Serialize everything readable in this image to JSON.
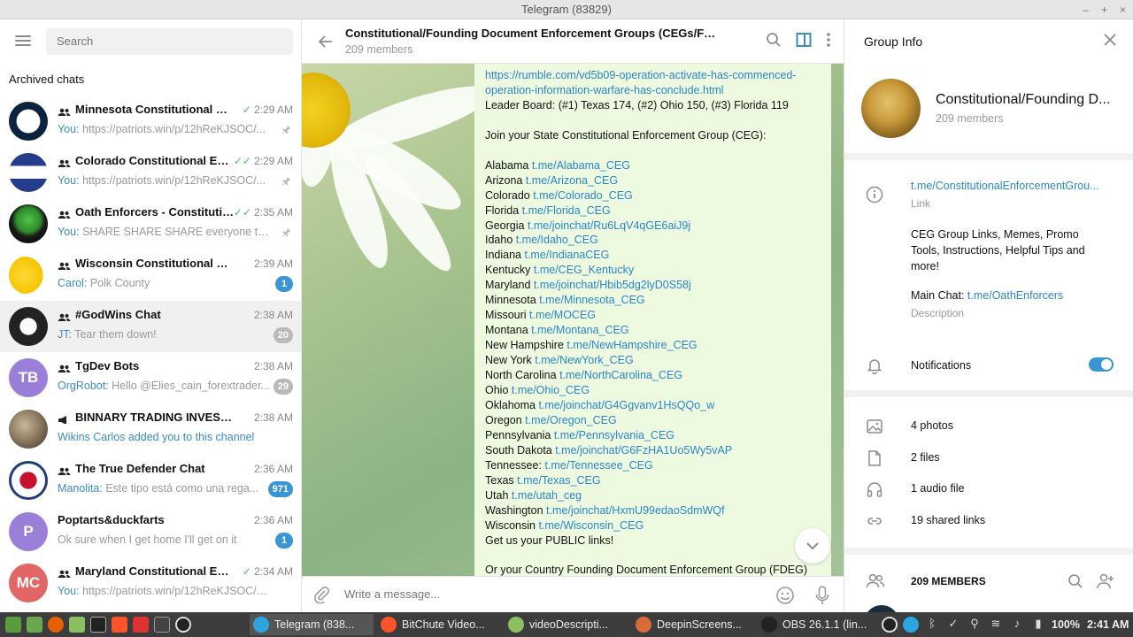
{
  "window": {
    "title": "Telegram (83829)"
  },
  "sidebar": {
    "search_placeholder": "Search",
    "section": "Archived chats",
    "chats": [
      {
        "name": "Minnesota Constitutional En...",
        "time": "2:29 AM",
        "who": "You:",
        "preview": "https://patriots.win/p/12hReKJSOC/...",
        "pinned": true,
        "avatar": "twins",
        "check": "✓"
      },
      {
        "name": "Colorado Constitutional Enf...",
        "time": "2:29 AM",
        "who": "You:",
        "preview": "https://patriots.win/p/12hReKJSOC/...",
        "pinned": true,
        "avatar": "colorado",
        "check": "✓✓"
      },
      {
        "name": "Oath Enforcers - Constitutio...",
        "time": "2:35 AM",
        "who": "You:",
        "preview": "SHARE SHARE SHARE everyone that ...",
        "pinned": true,
        "avatar": "button",
        "check": "✓✓"
      },
      {
        "name": "Wisconsin Constitutional Enfor...",
        "time": "2:39 AM",
        "who": "Carol:",
        "preview": "Polk County",
        "badge": "1",
        "avatar": "cheese"
      },
      {
        "name": "#GodWins Chat",
        "time": "2:38 AM",
        "who": "JT:",
        "preview": "Tear them down!",
        "badge": "20",
        "badge_muted": true,
        "avatar": "seal"
      },
      {
        "name": "TgDev Bots",
        "time": "2:38 AM",
        "who": "OrgRobot:",
        "preview": "Hello @Elies_cain_forextrader...",
        "badge": "29",
        "badge_muted": true,
        "avatar": "TB",
        "avatar_color": "#9b7ed8"
      },
      {
        "name": "BINNARY TRADING INVESTMENT",
        "time": "2:38 AM",
        "who": "",
        "preview": "Wikins Carlos added you to this channel",
        "preview_link": true,
        "avatar": "photo",
        "channel": true
      },
      {
        "name": "The True Defender Chat",
        "time": "2:36 AM",
        "who": "Manolita:",
        "preview": "Este tipo está como una rega...",
        "badge": "971",
        "avatar": "td"
      },
      {
        "name": "Poptarts&duckfarts",
        "time": "2:36 AM",
        "who": "",
        "preview": "Ok sure when I get home I'll get on it",
        "badge": "1",
        "avatar": "P",
        "avatar_color": "#9b7ed8",
        "no_group_icon": true
      },
      {
        "name": "Maryland Constitutional Enf...",
        "time": "2:34 AM",
        "who": "You:",
        "preview": "https://patriots.win/p/12hReKJSOC/oper...",
        "avatar": "MC",
        "avatar_color": "#e36666",
        "check": "✓"
      }
    ]
  },
  "chat": {
    "title": "Constitutional/Founding Document Enforcement Groups (CEGs/FDEG...",
    "subtitle": "209 members",
    "composer_placeholder": "Write a message...",
    "message_lines": [
      {
        "link": "https://rumble.com/vd5b09-operation-activate-has-commenced-"
      },
      {
        "link": "operation-information-warfare-has-conclude.html"
      },
      {
        "text": "Leader Board: (#1) Texas 174, (#2) Ohio 150, (#3) Florida 119"
      },
      {
        "text": ""
      },
      {
        "text": "Join your State Constitutional Enforcement Group (CEG):"
      },
      {
        "text": ""
      },
      {
        "text": "Alabama ",
        "link": "t.me/Alabama_CEG"
      },
      {
        "text": "Arizona ",
        "link": "t.me/Arizona_CEG"
      },
      {
        "text": "Colorado ",
        "link": "t.me/Colorado_CEG"
      },
      {
        "text": "Florida ",
        "link": "t.me/Florida_CEG"
      },
      {
        "text": "Georgia ",
        "link": "t.me/joinchat/Ru6LqV4qGE6aiJ9j"
      },
      {
        "text": "Idaho ",
        "link": "t.me/Idaho_CEG"
      },
      {
        "text": "Indiana ",
        "link": "t.me/IndianaCEG"
      },
      {
        "text": "Kentucky ",
        "link": "t.me/CEG_Kentucky"
      },
      {
        "text": "Maryland ",
        "link": "t.me/joinchat/Hbib5dg2lyD0S58j"
      },
      {
        "text": "Minnesota ",
        "link": "t.me/Minnesota_CEG"
      },
      {
        "text": "Missouri ",
        "link": "t.me/MOCEG"
      },
      {
        "text": "Montana ",
        "link": "t.me/Montana_CEG"
      },
      {
        "text": "New Hampshire ",
        "link": "t.me/NewHampshire_CEG"
      },
      {
        "text": "New York ",
        "link": "t.me/NewYork_CEG"
      },
      {
        "text": "North Carolina ",
        "link": "t.me/NorthCarolina_CEG"
      },
      {
        "text": "Ohio ",
        "link": "t.me/Ohio_CEG"
      },
      {
        "text": "Oklahoma ",
        "link": "t.me/joinchat/G4Ggvanv1HsQQo_w"
      },
      {
        "text": "Oregon ",
        "link": "t.me/Oregon_CEG"
      },
      {
        "text": "Pennsylvania ",
        "link": "t.me/Pennsylvania_CEG"
      },
      {
        "text": "South Dakota ",
        "link": "t.me/joinchat/G6FzHA1Uo5Wy5vAP"
      },
      {
        "text": "Tennessee: ",
        "link": "t.me/Tennessee_CEG"
      },
      {
        "text": "Texas ",
        "link": "t.me/Texas_CEG"
      },
      {
        "text": "Utah ",
        "link": "t.me/utah_ceg"
      },
      {
        "text": "Washington ",
        "link": "t.me/joinchat/HxmU99edaoSdmWQf"
      },
      {
        "text": "Wisconsin ",
        "link": "t.me/Wisconsin_CEG"
      },
      {
        "text": "Get us your PUBLIC links!"
      },
      {
        "text": ""
      },
      {
        "text": "Or your Country Founding Document Enforcement Group (FDEG)"
      }
    ]
  },
  "info": {
    "header": "Group Info",
    "name": "Constitutional/Founding D...",
    "members": "209 members",
    "link": "t.me/ConstitutionalEnforcementGrou...",
    "link_label": "Link",
    "description": [
      "CEG Group Links, Memes, Promo",
      "Tools, Instructions, Helpful Tips and",
      "more!"
    ],
    "main_chat_label": "Main Chat: ",
    "main_chat_link": "t.me/OathEnforcers",
    "description_label": "Description",
    "notifications": "Notifications",
    "notifications_on": true,
    "media": [
      {
        "icon": "photo-icon",
        "label": "4 photos"
      },
      {
        "icon": "file-icon",
        "label": "2 files"
      },
      {
        "icon": "headphones-icon",
        "label": "1 audio file"
      },
      {
        "icon": "link-icon",
        "label": "19 shared links"
      }
    ],
    "members_header": "209 MEMBERS"
  },
  "taskbar": {
    "windows": [
      {
        "label": "Telegram (838...",
        "active": true
      },
      {
        "label": "BitChute Video..."
      },
      {
        "label": "videoDescripti..."
      },
      {
        "label": "DeepinScreens..."
      },
      {
        "label": "OBS 26.1.1 (lin..."
      }
    ],
    "battery": "100%",
    "clock": "2:41 AM"
  }
}
